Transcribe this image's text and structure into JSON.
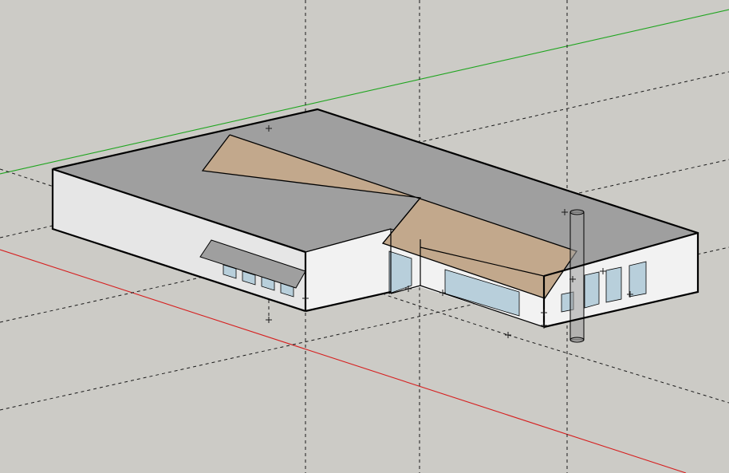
{
  "viewport": {
    "tool": "orbit"
  },
  "scene": {
    "background_color": "#cccbc6",
    "axes": {
      "red_axis_color": "#d61e1e",
      "green_axis_color": "#1fa51f"
    },
    "guide_line_color": "#1a1a1a",
    "roof_color": "#9f9f9f",
    "wall_color": "#f2f2f2",
    "wall_shade_color": "#e6e6e6",
    "sloped_roof_color": "#c2a88c",
    "glass_color": "#b8cfdb",
    "edge_color": "#000000"
  }
}
